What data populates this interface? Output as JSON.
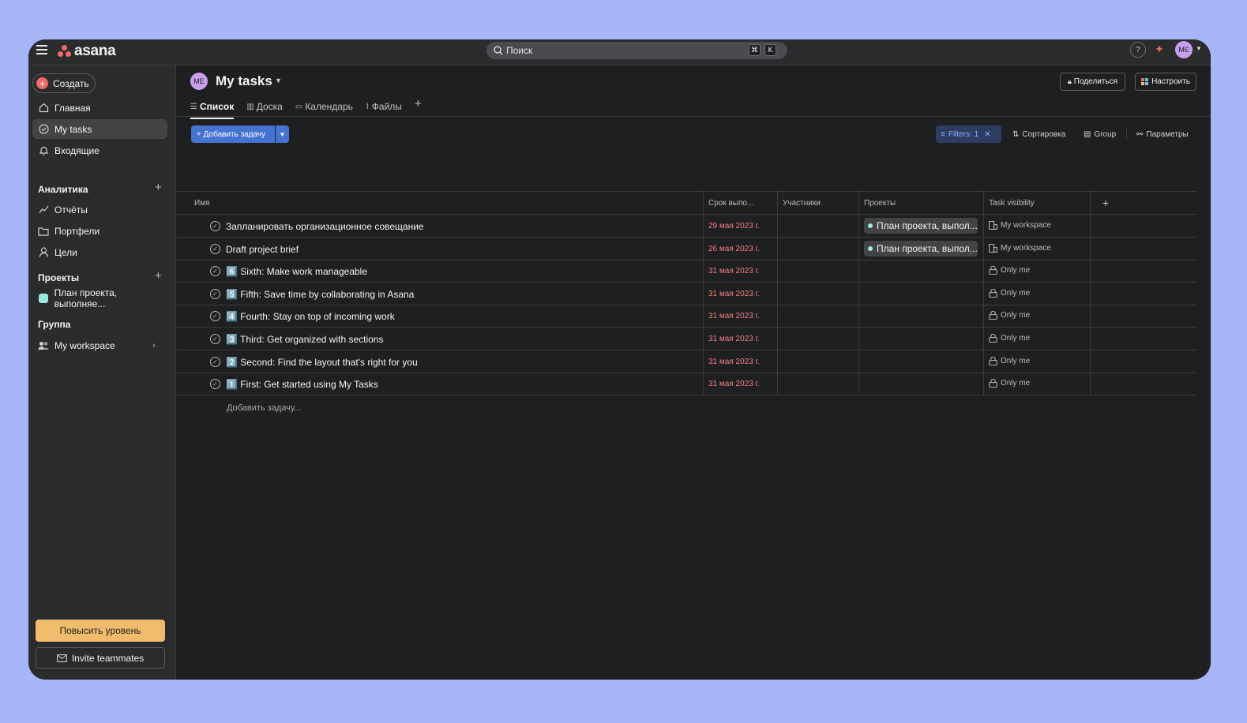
{
  "brand": {
    "name": "asana",
    "accent": "#f06a6a"
  },
  "topbar": {
    "search_placeholder": "Поиск",
    "shortcut_keys": [
      "⌘",
      "K"
    ],
    "help_label": "?",
    "avatar_initials": "ME"
  },
  "sidebar": {
    "create_label": "Создать",
    "nav": [
      {
        "label": "Главная",
        "icon": "home-icon"
      },
      {
        "label": "My tasks",
        "icon": "check-circle-icon",
        "active": true
      },
      {
        "label": "Входящие",
        "icon": "bell-icon"
      }
    ],
    "analytics": {
      "title": "Аналитика",
      "items": [
        {
          "label": "Отчёты",
          "icon": "chart-line-icon"
        },
        {
          "label": "Портфели",
          "icon": "folder-icon"
        },
        {
          "label": "Цели",
          "icon": "person-icon"
        }
      ]
    },
    "projects": {
      "title": "Проекты",
      "items": [
        {
          "label": "План проекта, выполняе...",
          "color": "#9ee7e3"
        }
      ]
    },
    "team": {
      "title": "Группа",
      "items": [
        {
          "label": "My workspace",
          "icon": "people-icon"
        }
      ]
    },
    "upgrade_label": "Повысить уровень",
    "invite_label": "Invite teammates"
  },
  "page": {
    "avatar_initials": "ME",
    "title": "My tasks",
    "share_label": "Поделиться",
    "customize_label": "Настроить",
    "tabs": [
      {
        "label": "Список",
        "icon": "list-icon",
        "active": true
      },
      {
        "label": "Доска",
        "icon": "board-icon"
      },
      {
        "label": "Календарь",
        "icon": "calendar-icon"
      },
      {
        "label": "Файлы",
        "icon": "paperclip-icon"
      }
    ]
  },
  "toolbar": {
    "add_task_label": "+ Добавить задачу",
    "filters_label": "Filters: 1",
    "sort_label": "Сортировка",
    "group_label": "Group",
    "options_label": "Параметры"
  },
  "table": {
    "columns": [
      "Имя",
      "Срок выпо...",
      "Участники",
      "Проекты",
      "Task visibility"
    ],
    "rows": [
      {
        "name": "Запланировать организационное совещание",
        "due": "29 мая 2023 г.",
        "project": "План проекта, выпол...",
        "visibility": "My workspace"
      },
      {
        "name": "Draft project brief",
        "due": "26 мая 2023 г.",
        "project": "План проекта, выпол...",
        "visibility": "My workspace"
      },
      {
        "name": "6️⃣ Sixth: Make work manageable",
        "due": "31 мая 2023 г.",
        "project": "",
        "visibility": "Only me"
      },
      {
        "name": "5️⃣ Fifth: Save time by collaborating in Asana",
        "due": "31 мая 2023 г.",
        "project": "",
        "visibility": "Only me"
      },
      {
        "name": "4️⃣ Fourth: Stay on top of incoming work",
        "due": "31 мая 2023 г.",
        "project": "",
        "visibility": "Only me"
      },
      {
        "name": "3️⃣ Third: Get organized with sections",
        "due": "31 мая 2023 г.",
        "project": "",
        "visibility": "Only me"
      },
      {
        "name": "2️⃣ Second: Find the layout that's right for you",
        "due": "31 мая 2023 г.",
        "project": "",
        "visibility": "Only me"
      },
      {
        "name": "1️⃣ First: Get started using My Tasks",
        "due": "31 мая 2023 г.",
        "project": "",
        "visibility": "Only me"
      }
    ],
    "add_task_placeholder": "Добавить задачу..."
  }
}
